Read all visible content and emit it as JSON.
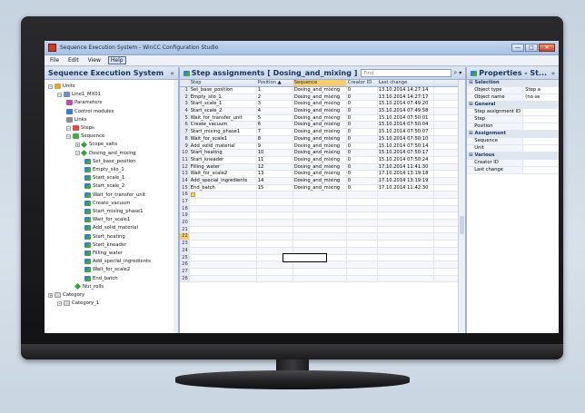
{
  "window": {
    "title": "Sequence Execution System - WinCC Configuration Studio",
    "min_label": "—",
    "max_label": "□",
    "close_label": "✕"
  },
  "menu": [
    "File",
    "Edit",
    "View",
    "Help"
  ],
  "left_panel": {
    "title": "Sequence Execution System",
    "collapse_glyph": "«",
    "tree": [
      {
        "label": "Units",
        "icon": "unit-icon",
        "level": 0
      },
      {
        "label": "Line1_MX01",
        "icon": "line-icon",
        "level": 1
      },
      {
        "label": "Parameters",
        "icon": "parameters-icon",
        "level": 2
      },
      {
        "label": "Control modules",
        "icon": "control-modules-icon",
        "level": 2
      },
      {
        "label": "Links",
        "icon": "links-icon",
        "level": 2
      },
      {
        "label": "Steps",
        "icon": "steps-icon",
        "level": 2
      },
      {
        "label": "Sequence",
        "icon": "sequence-icon",
        "level": 2
      },
      {
        "label": "Scope_salts",
        "icon": "diamond-icon",
        "level": 3
      },
      {
        "label": "Dosing_and_mixing",
        "icon": "diamond-icon",
        "level": 3
      },
      {
        "label": "Set_base_position",
        "icon": "step-icon",
        "level": 4
      },
      {
        "label": "Empty_silo_1",
        "icon": "step-icon",
        "level": 4
      },
      {
        "label": "Start_scale_1",
        "icon": "step-icon",
        "level": 4
      },
      {
        "label": "Start_scale_2",
        "icon": "step-icon",
        "level": 4
      },
      {
        "label": "Wait_for_transfer_unit",
        "icon": "step-icon",
        "level": 4
      },
      {
        "label": "Create_vacuum",
        "icon": "step-icon",
        "level": 4
      },
      {
        "label": "Start_mixing_phase1",
        "icon": "step-icon",
        "level": 4
      },
      {
        "label": "Wait_for_scale1",
        "icon": "step-icon",
        "level": 4
      },
      {
        "label": "Add_solid_material",
        "icon": "step-icon",
        "level": 4
      },
      {
        "label": "Start_heating",
        "icon": "step-icon",
        "level": 4
      },
      {
        "label": "Start_kneader",
        "icon": "step-icon",
        "level": 4
      },
      {
        "label": "Filling_water",
        "icon": "step-icon",
        "level": 4
      },
      {
        "label": "Add_special_ingredients",
        "icon": "step-icon",
        "level": 4
      },
      {
        "label": "Wait_for_scale2",
        "icon": "step-icon",
        "level": 4
      },
      {
        "label": "End_batch",
        "icon": "step-icon",
        "level": 4
      },
      {
        "label": "Nut_rolls",
        "icon": "diamond-icon",
        "level": 3
      },
      {
        "label": "Category",
        "icon": "category-icon",
        "level": 0
      },
      {
        "label": "Category_1",
        "icon": "category-icon",
        "level": 1
      }
    ]
  },
  "center_panel": {
    "title": "Step assignments [ Dosing_and_mixing ]",
    "find_placeholder": "Find",
    "columns": [
      "Step",
      "Position ▲",
      "Sequence",
      "Creator ID",
      "Last change"
    ],
    "rows": [
      {
        "n": "1",
        "step": "Set_base_position",
        "pos": "1",
        "seq": "Dosing_and_mixing",
        "cre": "0",
        "chg": "13.10.2014 14:27:14"
      },
      {
        "n": "2",
        "step": "Empty_silo_1",
        "pos": "2",
        "seq": "Dosing_and_mixing",
        "cre": "0",
        "chg": "13.10.2014 14:27:17"
      },
      {
        "n": "3",
        "step": "Start_scale_1",
        "pos": "3",
        "seq": "Dosing_and_mixing",
        "cre": "0",
        "chg": "15.10.2014 07:49:20"
      },
      {
        "n": "4",
        "step": "Start_scale_2",
        "pos": "4",
        "seq": "Dosing_and_mixing",
        "cre": "0",
        "chg": "15.10.2014 07:49:58"
      },
      {
        "n": "5",
        "step": "Wait_for_transfer_unit",
        "pos": "5",
        "seq": "Dosing_and_mixing",
        "cre": "0",
        "chg": "15.10.2014 07:50:01"
      },
      {
        "n": "6",
        "step": "Create_vacuum",
        "pos": "6",
        "seq": "Dosing_and_mixing",
        "cre": "0",
        "chg": "15.10.2014 07:50:04"
      },
      {
        "n": "7",
        "step": "Start_mixing_phase1",
        "pos": "7",
        "seq": "Dosing_and_mixing",
        "cre": "0",
        "chg": "15.10.2014 07:50:07"
      },
      {
        "n": "8",
        "step": "Wait_for_scale1",
        "pos": "8",
        "seq": "Dosing_and_mixing",
        "cre": "0",
        "chg": "15.10.2014 07:50:10"
      },
      {
        "n": "9",
        "step": "Add_solid_material",
        "pos": "9",
        "seq": "Dosing_and_mixing",
        "cre": "0",
        "chg": "15.10.2014 07:50:14"
      },
      {
        "n": "10",
        "step": "Start_heating",
        "pos": "10",
        "seq": "Dosing_and_mixing",
        "cre": "0",
        "chg": "15.10.2014 07:50:17"
      },
      {
        "n": "11",
        "step": "Start_kneader",
        "pos": "11",
        "seq": "Dosing_and_mixing",
        "cre": "0",
        "chg": "15.10.2014 07:50:24"
      },
      {
        "n": "12",
        "step": "Filling_water",
        "pos": "12",
        "seq": "Dosing_and_mixing",
        "cre": "0",
        "chg": "17.10.2014 11:41:30"
      },
      {
        "n": "13",
        "step": "Wait_for_scale2",
        "pos": "13",
        "seq": "Dosing_and_mixing",
        "cre": "0",
        "chg": "17.10.2014 13:19:18"
      },
      {
        "n": "14",
        "step": "Add_special_ingredients",
        "pos": "14",
        "seq": "Dosing_and_mixing",
        "cre": "0",
        "chg": "17.10.2014 13:19:19"
      },
      {
        "n": "15",
        "step": "End_batch",
        "pos": "15",
        "seq": "Dosing_and_mixing",
        "cre": "0",
        "chg": "17.10.2014 11:42:30"
      },
      {
        "n": "16",
        "step": "",
        "pos": "",
        "seq": "",
        "cre": "",
        "chg": ""
      },
      {
        "n": "17",
        "step": "",
        "pos": "",
        "seq": "",
        "cre": "",
        "chg": ""
      },
      {
        "n": "18",
        "step": "",
        "pos": "",
        "seq": "",
        "cre": "",
        "chg": ""
      },
      {
        "n": "19",
        "step": "",
        "pos": "",
        "seq": "",
        "cre": "",
        "chg": ""
      },
      {
        "n": "20",
        "step": "",
        "pos": "",
        "seq": "",
        "cre": "",
        "chg": ""
      },
      {
        "n": "21",
        "step": "",
        "pos": "",
        "seq": "",
        "cre": "",
        "chg": ""
      },
      {
        "n": "22",
        "step": "",
        "pos": "",
        "seq": "",
        "cre": "",
        "chg": ""
      },
      {
        "n": "23",
        "step": "",
        "pos": "",
        "seq": "",
        "cre": "",
        "chg": ""
      },
      {
        "n": "24",
        "step": "",
        "pos": "",
        "seq": "",
        "cre": "",
        "chg": ""
      },
      {
        "n": "25",
        "step": "",
        "pos": "",
        "seq": "",
        "cre": "",
        "chg": ""
      },
      {
        "n": "26",
        "step": "",
        "pos": "",
        "seq": "",
        "cre": "",
        "chg": ""
      },
      {
        "n": "27",
        "step": "",
        "pos": "",
        "seq": "",
        "cre": "",
        "chg": ""
      },
      {
        "n": "28",
        "step": "",
        "pos": "",
        "seq": "",
        "cre": "",
        "chg": ""
      }
    ],
    "selected_row": "22",
    "marker_row": "16"
  },
  "right_panel": {
    "title": "Properties - St...",
    "close_glyph": "»",
    "sections": [
      {
        "name": "Selection",
        "props": [
          {
            "key": "Object type",
            "val": "Step a"
          },
          {
            "key": "Object name",
            "val": "(no se"
          }
        ]
      },
      {
        "name": "General",
        "props": [
          {
            "key": "Step assignment ID",
            "val": ""
          },
          {
            "key": "Step",
            "val": ""
          },
          {
            "key": "Position",
            "val": ""
          }
        ]
      },
      {
        "name": "Assignment",
        "props": [
          {
            "key": "Sequence",
            "val": ""
          },
          {
            "key": "Unit",
            "val": ""
          }
        ]
      },
      {
        "name": "Various",
        "props": [
          {
            "key": "Creator ID",
            "val": ""
          },
          {
            "key": "Last change",
            "val": ""
          }
        ]
      }
    ]
  },
  "colors": {
    "highlight": "#f3cc73",
    "header_blue": "#16345f"
  }
}
